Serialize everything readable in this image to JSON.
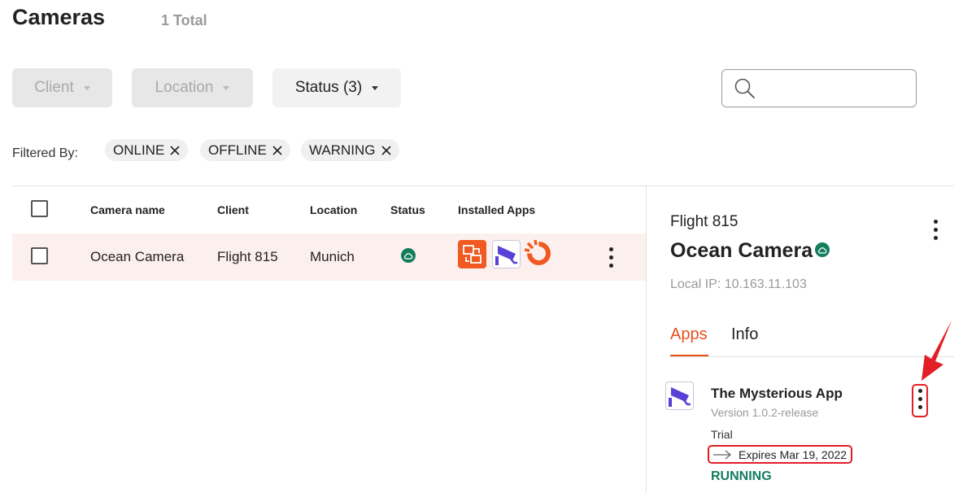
{
  "header": {
    "title": "Cameras",
    "total": "1 Total"
  },
  "filters": {
    "client_label": "Client",
    "location_label": "Location",
    "status_label": "Status (3)",
    "search_placeholder": ""
  },
  "filtered_by": {
    "label": "Filtered By:",
    "chips": [
      "ONLINE",
      "OFFLINE",
      "WARNING"
    ]
  },
  "table": {
    "columns": [
      "Camera name",
      "Client",
      "Location",
      "Status",
      "Installed Apps"
    ],
    "rows": [
      {
        "camera_name": "Ocean Camera",
        "client": "Flight 815",
        "location": "Munich",
        "status": "online",
        "apps": [
          "screen-transfer-app-icon",
          "security-camera-app-icon",
          "orange-ring-app-icon"
        ]
      }
    ]
  },
  "detail_panel": {
    "client": "Flight 815",
    "camera_name": "Ocean Camera",
    "local_ip": "Local IP: 10.163.11.103",
    "tabs": [
      {
        "label": "Apps",
        "active": true
      },
      {
        "label": "Info",
        "active": false
      }
    ],
    "app": {
      "name": "The Mysterious App",
      "version": "Version 1.0.2-release",
      "license": "Trial",
      "expires": "Expires Mar 19, 2022",
      "state": "RUNNING"
    }
  },
  "colors": {
    "accent": "#e8501e",
    "online": "#137d5d",
    "annotation": "#e21e26",
    "row_highlight": "#fcf0ee"
  }
}
